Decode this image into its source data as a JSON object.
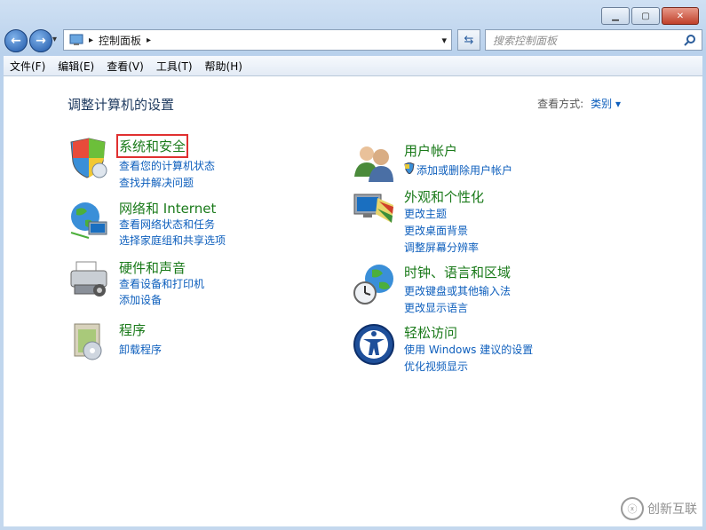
{
  "window": {
    "minimize": "▁",
    "maximize": "▢",
    "close": "✕"
  },
  "nav": {
    "back": "←",
    "forward": "→",
    "crumb_arrow": "▸",
    "crumb_current": "控制面板",
    "crumb_end": "▸",
    "dropdown": "▾",
    "refresh": "⇆"
  },
  "search": {
    "placeholder": "搜索控制面板",
    "icon": "magnifier-icon"
  },
  "menu": [
    "文件(F)",
    "编辑(E)",
    "查看(V)",
    "工具(T)",
    "帮助(H)"
  ],
  "page": {
    "title": "调整计算机的设置",
    "view_by_label": "查看方式:",
    "view_by_value": "类别 ▾"
  },
  "left_categories": [
    {
      "title": "系统和安全",
      "links": [
        "查看您的计算机状态",
        "查找并解决问题"
      ],
      "icon": "shield-icon"
    },
    {
      "title": "网络和 Internet",
      "links": [
        "查看网络状态和任务",
        "选择家庭组和共享选项"
      ],
      "icon": "network-icon"
    },
    {
      "title": "硬件和声音",
      "links": [
        "查看设备和打印机",
        "添加设备"
      ],
      "icon": "printer-icon"
    },
    {
      "title": "程序",
      "links": [
        "卸载程序"
      ],
      "icon": "program-icon"
    }
  ],
  "right_categories": [
    {
      "title": "用户帐户",
      "links": [
        "添加或删除用户帐户"
      ],
      "icon": "users-icon"
    },
    {
      "title": "外观和个性化",
      "links": [
        "更改主题",
        "更改桌面背景",
        "调整屏幕分辨率"
      ],
      "icon": "appearance-icon"
    },
    {
      "title": "时钟、语言和区域",
      "links": [
        "更改键盘或其他输入法",
        "更改显示语言"
      ],
      "icon": "clock-globe-icon"
    },
    {
      "title": "轻松访问",
      "links": [
        "使用 Windows 建议的设置",
        "优化视频显示"
      ],
      "icon": "accessibility-icon"
    }
  ],
  "watermark": {
    "text": "创新互联",
    "logo": "ⓧ"
  }
}
